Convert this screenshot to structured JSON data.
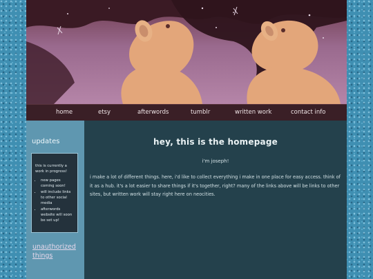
{
  "nav": {
    "items": [
      {
        "label": "home"
      },
      {
        "label": "etsy"
      },
      {
        "label": "afterwords"
      },
      {
        "label": "tumblr"
      },
      {
        "label": "written work"
      },
      {
        "label": "contact info"
      }
    ]
  },
  "sidebar": {
    "title": "updates",
    "box_intro": "this is currently a work in progress!",
    "box_items": [
      "new pages coming soon!",
      "will include links to other social media",
      "afterwords website will soon be set up!"
    ],
    "link": "unauthorized things"
  },
  "main": {
    "title": "hey, this is the homepage",
    "subtitle": "i'm joseph!",
    "body": "i make a lot of different things. here, i'd like to collect everything i make in one place for easy access. think of it as a hub. it's a lot easier to share things if it's together, right? many of the links above will be links to other sites, but written work will stay right here on neocities."
  },
  "colors": {
    "nav_bg": "#3a1f26",
    "sidebar_bg": "#5f97b0",
    "main_bg": "#24414c",
    "page_bg": "#3f8fb2"
  }
}
